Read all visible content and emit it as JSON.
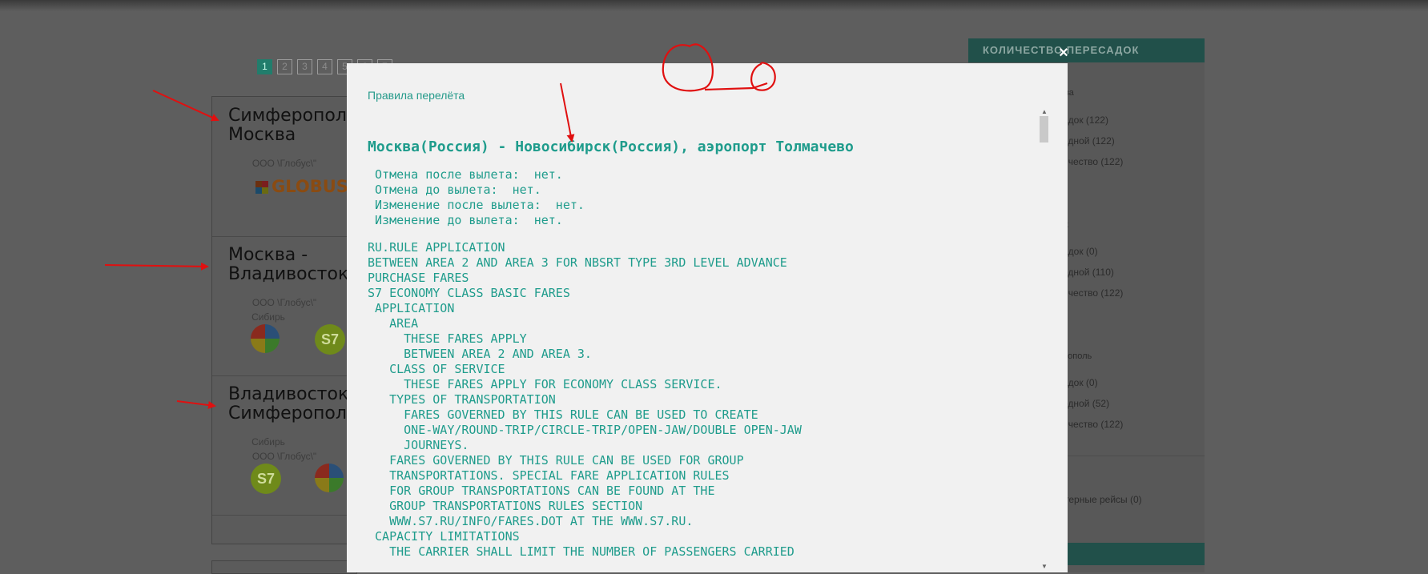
{
  "pagination": {
    "pages": [
      "1",
      "2",
      "3",
      "4",
      "5",
      "6",
      "7"
    ],
    "active_index": 0
  },
  "cards": [
    {
      "title": "Симферополь -\nМосква",
      "agent": "ООО \\Глобус\\\"",
      "logo_text": "GLOBUS"
    },
    {
      "title": "Москва -\nВладивосток",
      "agent": "ООО \\Глобус\\\"",
      "agent2": "Сибирь",
      "logo_text": "S7"
    },
    {
      "title": "Владивосток -\nСимферополь",
      "agent": "Сибирь",
      "agent2": "ООО \\Глобус\\\"",
      "logo_text": "S7"
    }
  ],
  "sidebar": {
    "header": "КОЛИЧЕСТВО ПЕРЕСАДОК",
    "groups": [
      {
        "title": "ва",
        "items": [
          "адок (122)",
          "одной (122)",
          "ичество (122)"
        ]
      },
      {
        "title": "к",
        "items": [
          "адок (0)",
          "одной (110)",
          "ичество (122)"
        ]
      },
      {
        "title": "рополь",
        "items": [
          "адок (0)",
          "одной (52)",
          "ичество (122)"
        ]
      }
    ],
    "footer_items": [
      ")",
      "терные рейсы (0)"
    ]
  },
  "modal": {
    "caption": "Правила перелёта",
    "close_symbol": "×",
    "route_title": "Москва(Россия) - Новосибирск(Россия), аэропорт Толмачево",
    "summary": [
      " Отмена после вылета:  нет.",
      " Отмена до вылета:  нет.",
      " Изменение после вылета:  нет.",
      " Изменение до вылета:  нет."
    ],
    "rules_text": [
      "RU.RULE APPLICATION",
      "BETWEEN AREA 2 AND AREA 3 FOR NBSRT TYPE 3RD LEVEL ADVANCE",
      "PURCHASE FARES",
      "S7 ECONOMY CLASS BASIC FARES",
      " APPLICATION",
      "   AREA",
      "     THESE FARES APPLY",
      "     BETWEEN AREA 2 AND AREA 3.",
      "   CLASS OF SERVICE",
      "     THESE FARES APPLY FOR ECONOMY CLASS SERVICE.",
      "   TYPES OF TRANSPORTATION",
      "     FARES GOVERNED BY THIS RULE CAN BE USED TO CREATE",
      "     ONE-WAY/ROUND-TRIP/CIRCLE-TRIP/OPEN-JAW/DOUBLE OPEN-JAW",
      "     JOURNEYS.",
      "   FARES GOVERNED BY THIS RULE CAN BE USED FOR GROUP",
      "   TRANSPORTATIONS. SPECIAL FARE APPLICATION RULES",
      "   FOR GROUP TRANSPORTATIONS CAN BE FOUND AT THE",
      "   GROUP TRANSPORTATIONS RULES SECTION",
      "   WWW.S7.RU/INFO/FARES.DOT AT THE WWW.S7.RU.",
      " CAPACITY LIMITATIONS",
      "   THE CARRIER SHALL LIMIT THE NUMBER OF PASSENGERS CARRIED"
    ]
  },
  "colors": {
    "accent": "#1f9c8c",
    "annotation": "#e01010",
    "overlay": "#5e5e5e"
  }
}
